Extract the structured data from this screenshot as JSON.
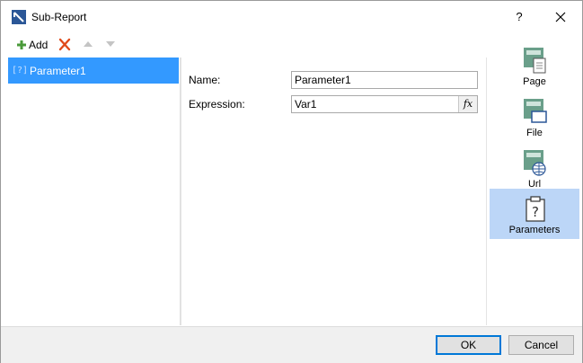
{
  "window": {
    "title": "Sub-Report",
    "help_label": "?"
  },
  "toolbar": {
    "add_label": "Add"
  },
  "parameters": {
    "items": [
      {
        "label": "Parameter1"
      }
    ]
  },
  "form": {
    "name_label": "Name:",
    "name_value": "Parameter1",
    "expression_label": "Expression:",
    "expression_value": "Var1",
    "fx_label": "fx"
  },
  "sidebar": {
    "items": [
      {
        "label": "Page",
        "icon": "page-icon"
      },
      {
        "label": "File",
        "icon": "file-icon"
      },
      {
        "label": "Url",
        "icon": "url-icon"
      },
      {
        "label": "Parameters",
        "icon": "parameters-icon",
        "active": true
      }
    ]
  },
  "footer": {
    "ok_label": "OK",
    "cancel_label": "Cancel"
  },
  "colors": {
    "selection": "#3399ff",
    "sidebar_active": "#bcd6f7",
    "accent": "#0078d7"
  }
}
